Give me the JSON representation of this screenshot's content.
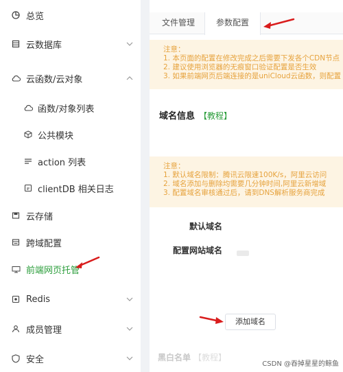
{
  "sidebar": {
    "items": [
      {
        "label": "总览",
        "icon": "pie-chart-icon"
      },
      {
        "label": "云数据库",
        "icon": "database-icon"
      },
      {
        "label": "云函数/云对象",
        "icon": "cloud-icon"
      },
      {
        "label": "函数/对象列表",
        "icon": "cloud-icon"
      },
      {
        "label": "公共模块",
        "icon": "cube-icon"
      },
      {
        "label": "action 列表",
        "icon": "list-icon"
      },
      {
        "label": "clientDB 相关日志",
        "icon": "log-icon"
      },
      {
        "label": "云存储",
        "icon": "storage-icon"
      },
      {
        "label": "跨域配置",
        "icon": "cross-domain-icon"
      },
      {
        "label": "前端网页托管",
        "icon": "web-hosting-icon"
      },
      {
        "label": "Redis",
        "icon": "redis-icon"
      },
      {
        "label": "成员管理",
        "icon": "user-icon"
      },
      {
        "label": "安全",
        "icon": "shield-icon"
      }
    ]
  },
  "tabs": [
    {
      "label": "文件管理"
    },
    {
      "label": "参数配置"
    }
  ],
  "notice1": {
    "title": "注意：",
    "lines": [
      "1. 本页面的配置在修改完成之后需要下发各个CDN节点",
      "2. 建议使用浏览器的无痕窗口验证配置是否生效",
      "3. 如果前端网页后端连接的是uniCloud云函数，则配置"
    ]
  },
  "section": {
    "title": "域名信息",
    "tutorial_link": "【教程】"
  },
  "notice2": {
    "title": "注意：",
    "lines": [
      "1. 默认域名限制：腾讯云限速100K/s，阿里云访问",
      "2. 域名添加与删除均需要几分钟时间,阿里云新增域",
      "3. 配置域名审核通过后，请到DNS解析服务商完成"
    ]
  },
  "fields": {
    "default_domain_label": "默认域名",
    "site_domain_label": "配置网站域名"
  },
  "add_domain_button": "添加域名",
  "next_section_title": "黑白名单",
  "next_section_link": "【教程】",
  "watermark": "CSDN @吞掉星星的鲸鱼",
  "colors": {
    "accent_green": "#2a9d3a",
    "notice_bg": "#fdf4e3",
    "notice_text": "#e6a23c",
    "arrow_red": "#d91c1c"
  }
}
